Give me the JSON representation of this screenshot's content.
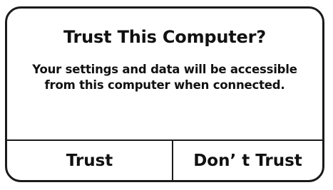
{
  "dialog": {
    "title": "Trust This Computer?",
    "message": "Your settings and data will be accessible from this computer when connected.",
    "buttons": {
      "trust": "Trust",
      "dont_trust": "Don’ t Trust"
    }
  }
}
